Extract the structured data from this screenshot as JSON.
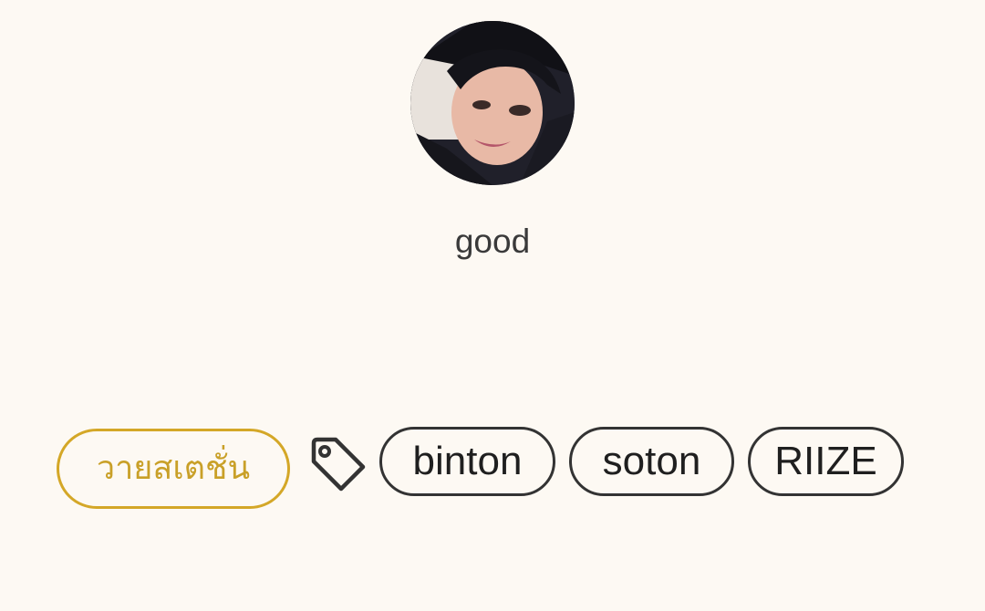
{
  "profile": {
    "name": "good",
    "avatar_alt": "avatar"
  },
  "tags": {
    "style_label": "วายสเตชั่น",
    "tag_icon": "tag-icon",
    "items": [
      {
        "label": "binton"
      },
      {
        "label": "soton"
      },
      {
        "label": "RIIZE"
      }
    ]
  },
  "colors": {
    "background": "#fdf9f3",
    "accent": "#d4a727",
    "chip_border": "#333333",
    "text": "#3a3a3a"
  }
}
